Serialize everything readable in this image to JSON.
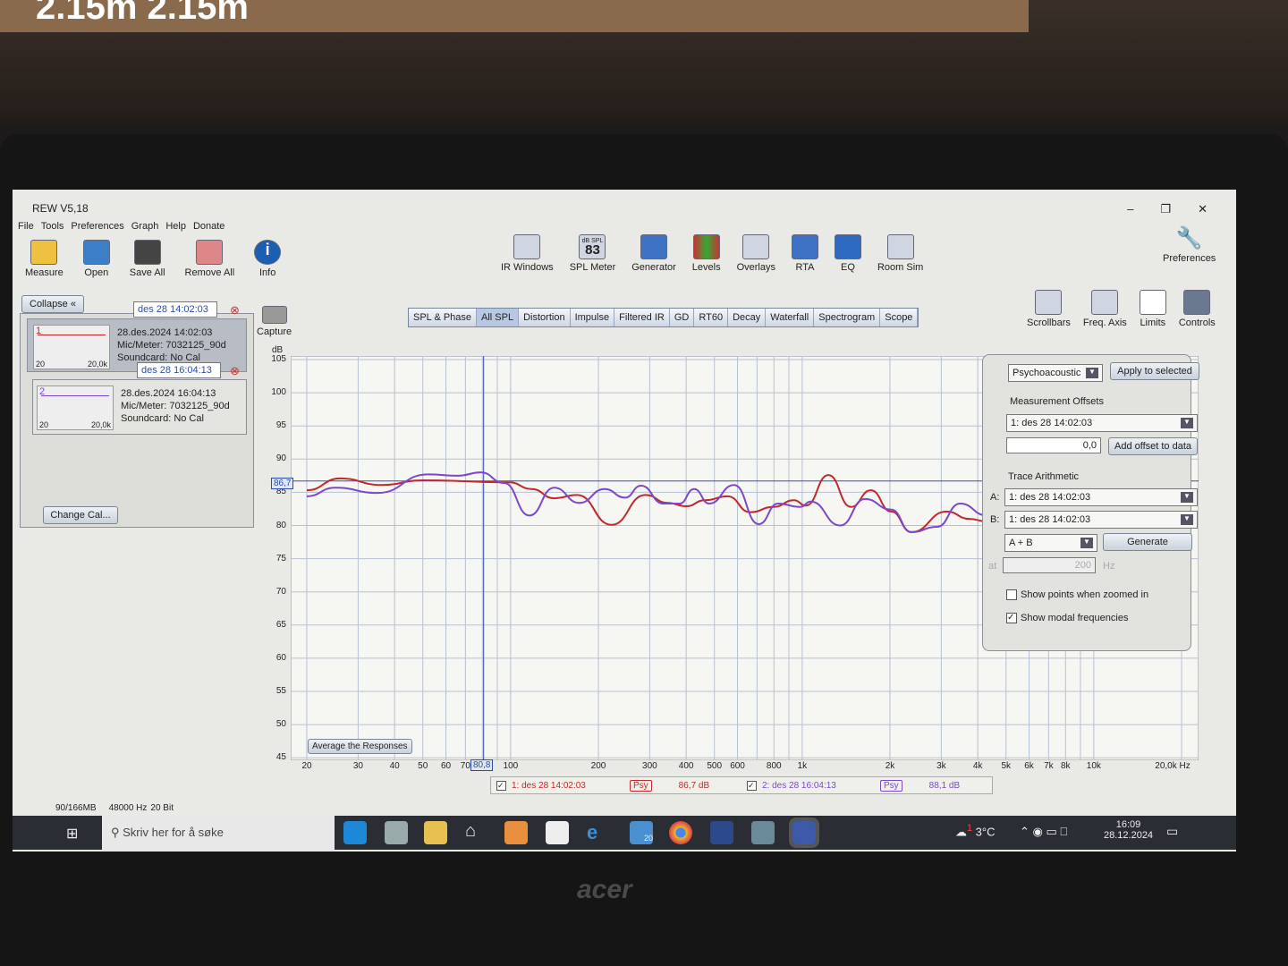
{
  "background": {
    "monitor_text": "2.15m  2.15m"
  },
  "window": {
    "title": "REW V5,18",
    "controls": [
      "–",
      "❐",
      "✕"
    ]
  },
  "menu": [
    "File",
    "Tools",
    "Preferences",
    "Graph",
    "Help",
    "Donate"
  ],
  "toolbar_left": [
    "Measure",
    "Open",
    "Save All",
    "Remove All",
    "Info"
  ],
  "toolbar_center": [
    {
      "label": "IR Windows"
    },
    {
      "label": "SPL Meter",
      "value": "83",
      "unit": "dB SPL"
    },
    {
      "label": "Generator"
    },
    {
      "label": "Levels"
    },
    {
      "label": "Overlays"
    },
    {
      "label": "RTA"
    },
    {
      "label": "EQ"
    },
    {
      "label": "Room Sim"
    }
  ],
  "toolbar_right": [
    "Preferences",
    "Scrollbars",
    "Freq. Axis",
    "Limits",
    "Controls"
  ],
  "capture_label": "Capture",
  "measurements": {
    "collapse": "Collapse",
    "items": [
      {
        "name": "des 28 14:02:03",
        "num": "1",
        "date": "28.des.2024 14:02:03",
        "mic": "Mic/Meter: 7032125_90d",
        "soundcard": "Soundcard: No Cal",
        "xmin": "20",
        "xmax": "20,0k",
        "color": "#c0282c"
      },
      {
        "name": "des 28 16:04:13",
        "num": "2",
        "date": "28.des.2024 16:04:13",
        "mic": "Mic/Meter: 7032125_90d",
        "soundcard": "Soundcard: No Cal",
        "xmin": "20",
        "xmax": "20,0k",
        "color": "#7a48c8"
      }
    ],
    "change_cal": "Change Cal..."
  },
  "tabs": [
    "SPL & Phase",
    "All SPL",
    "Distortion",
    "Impulse",
    "Filtered IR",
    "GD",
    "RT60",
    "Decay",
    "Waterfall",
    "Spectrogram",
    "Scope"
  ],
  "selected_tab": "All SPL",
  "controls_panel": {
    "smoothing": "Psychoacoustic",
    "apply": "Apply to selected",
    "offsets_title": "Measurement Offsets",
    "offset_meas": "1: des 28 14:02:03",
    "offset_value": "0,0",
    "add_offset": "Add offset to data",
    "arith_title": "Trace Arithmetic",
    "a_label": "A:",
    "a_value": "1: des 28 14:02:03",
    "b_label": "B:",
    "b_value": "1: des 28 14:02:03",
    "op": "A + B",
    "generate": "Generate",
    "at_label": "at",
    "freq_value": "200",
    "hz": "Hz",
    "show_points": "Show points when zoomed in",
    "show_points_checked": false,
    "show_modal": "Show modal frequencies",
    "show_modal_checked": true
  },
  "average_button": "Average the Responses",
  "legend": [
    {
      "label": "1: des 28 14:02:03",
      "smoothing": "Psy",
      "value": "86,7 dB",
      "color": "#c0282c"
    },
    {
      "label": "2: des 28 16:04:13",
      "smoothing": "Psy",
      "value": "88,1 dB",
      "color": "#7a48c8"
    }
  ],
  "chart_data": {
    "type": "line",
    "ylabel": "dB",
    "xlabel": "Hz",
    "ylim": [
      45,
      105
    ],
    "xlim": [
      20,
      20000
    ],
    "xscale": "log",
    "yticks": [
      105,
      100,
      95,
      90,
      85,
      80,
      75,
      70,
      65,
      60,
      55,
      50,
      45
    ],
    "xticks": [
      "20",
      "30",
      "40",
      "50",
      "60",
      "70",
      "100",
      "200",
      "300",
      "400",
      "500",
      "600",
      "800",
      "1k",
      "2k",
      "3k",
      "4k",
      "5k",
      "6k",
      "7k",
      "8k",
      "10k",
      "20,0k Hz"
    ],
    "xtick_values": [
      20,
      30,
      40,
      50,
      60,
      70,
      100,
      200,
      300,
      400,
      500,
      600,
      800,
      1000,
      2000,
      3000,
      4000,
      5000,
      6000,
      7000,
      8000,
      10000,
      20000
    ],
    "cursor": {
      "freq_label": "80,8",
      "freq": 80.8,
      "level_label": "86,7",
      "level": 86.7
    },
    "series": [
      {
        "name": "1: des 28 14:02:03",
        "color": "#c0282c",
        "points": [
          [
            20,
            85.3
          ],
          [
            26,
            87.1
          ],
          [
            36,
            86.1
          ],
          [
            50,
            86.8
          ],
          [
            99,
            86.5
          ],
          [
            118,
            85.5
          ],
          [
            141,
            84.1
          ],
          [
            169,
            84.6
          ],
          [
            222,
            80.1
          ],
          [
            290,
            84.6
          ],
          [
            346,
            83.4
          ],
          [
            401,
            82.9
          ],
          [
            463,
            83.8
          ],
          [
            555,
            84.4
          ],
          [
            663,
            82
          ],
          [
            798,
            82.8
          ],
          [
            937,
            83.8
          ],
          [
            1030,
            83
          ],
          [
            1230,
            87.6
          ],
          [
            1470,
            82.8
          ],
          [
            1720,
            85.3
          ],
          [
            2020,
            82.1
          ],
          [
            2370,
            79
          ],
          [
            3130,
            82.1
          ],
          [
            3740,
            81
          ],
          [
            4300,
            80.6
          ]
        ]
      },
      {
        "name": "2: des 28 16:04:13",
        "color": "#7a48c8",
        "points": [
          [
            20,
            84.4
          ],
          [
            25,
            85.7
          ],
          [
            35,
            84.9
          ],
          [
            52,
            87.7
          ],
          [
            66,
            87.5
          ],
          [
            79,
            88
          ],
          [
            95,
            86.4
          ],
          [
            116,
            81.5
          ],
          [
            141,
            85.7
          ],
          [
            172,
            83.4
          ],
          [
            210,
            85.5
          ],
          [
            247,
            84.2
          ],
          [
            280,
            86
          ],
          [
            334,
            83.3
          ],
          [
            380,
            83.3
          ],
          [
            426,
            85.5
          ],
          [
            480,
            83.3
          ],
          [
            584,
            86.1
          ],
          [
            710,
            80.2
          ],
          [
            826,
            83.3
          ],
          [
            985,
            82.8
          ],
          [
            1070,
            83.6
          ],
          [
            1350,
            80
          ],
          [
            1640,
            84
          ],
          [
            2020,
            82.4
          ],
          [
            2370,
            79
          ],
          [
            2900,
            79.8
          ],
          [
            3480,
            83.3
          ],
          [
            4300,
            81.5
          ]
        ]
      }
    ]
  },
  "status": {
    "memory": "90/166MB",
    "rate": "48000 Hz",
    "bits": "20 Bit"
  },
  "taskbar": {
    "search": "Skriv her for å søke",
    "mail_badge": "20",
    "weather": "3°C",
    "weather_badge": "1",
    "time": "16:09",
    "date": "28.12.2024"
  },
  "laptop_brand": "acer"
}
